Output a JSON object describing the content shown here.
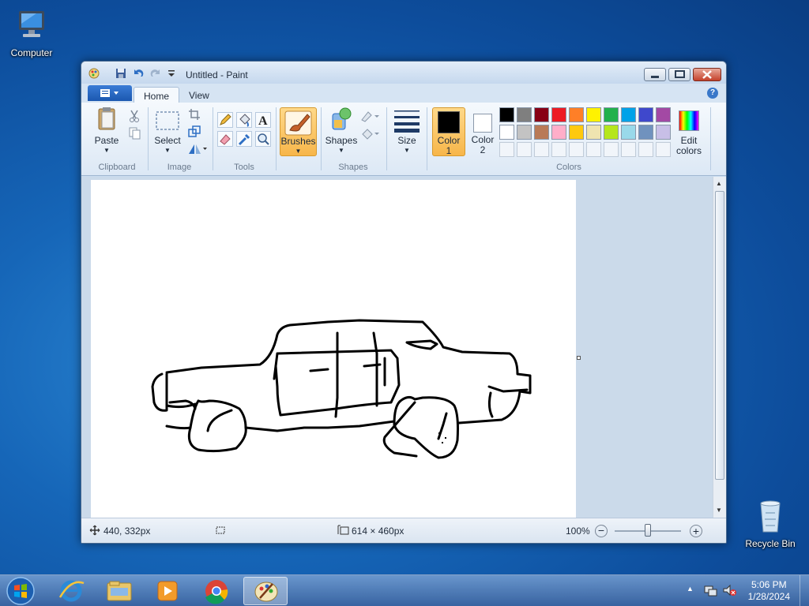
{
  "desktop": {
    "icons": [
      {
        "label": "Computer"
      },
      {
        "label": "Recycle Bin"
      }
    ]
  },
  "window": {
    "title": "Untitled - Paint",
    "tabs": [
      {
        "label": "Home"
      },
      {
        "label": "View"
      }
    ],
    "ribbon": {
      "clipboard": {
        "paste": "Paste",
        "group": "Clipboard"
      },
      "image": {
        "select": "Select",
        "group": "Image"
      },
      "tools": {
        "group": "Tools"
      },
      "brushes": {
        "label": "Brushes"
      },
      "shapes": {
        "label": "Shapes",
        "group": "Shapes"
      },
      "size": {
        "label": "Size"
      },
      "color1": {
        "line1": "Color",
        "line2": "1"
      },
      "color2": {
        "line1": "Color",
        "line2": "2"
      },
      "colors": {
        "group": "Colors"
      },
      "edit_colors": {
        "line1": "Edit",
        "line2": "colors"
      }
    },
    "palette_row1": [
      "#000000",
      "#7f7f7f",
      "#880015",
      "#ed1c24",
      "#ff7f27",
      "#fff200",
      "#22b14c",
      "#00a2e8",
      "#3f48cc",
      "#a349a4"
    ],
    "palette_row2": [
      "#ffffff",
      "#c3c3c3",
      "#b97a57",
      "#ffaec9",
      "#ffc90e",
      "#efe4b0",
      "#b5e61d",
      "#99d9ea",
      "#7092be",
      "#c8bfe7"
    ],
    "status": {
      "cursor": "440, 332px",
      "size": "614 × 460px",
      "zoom": "100%"
    }
  },
  "taskbar": {
    "time": "5:06 PM",
    "date": "1/28/2024"
  }
}
